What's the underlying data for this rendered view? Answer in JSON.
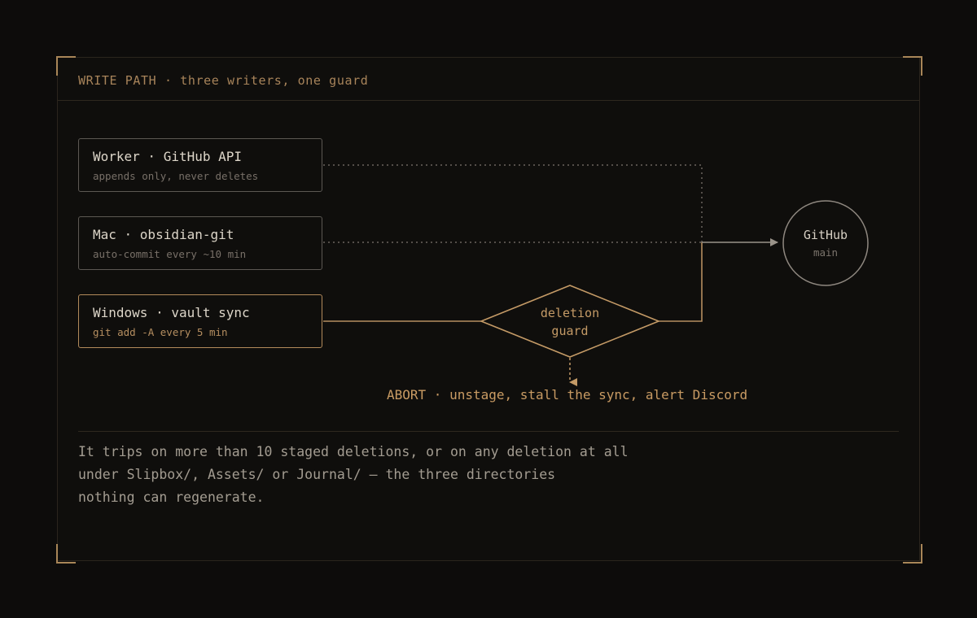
{
  "header": {
    "title": "WRITE PATH · three writers, one guard"
  },
  "writers": [
    {
      "name": "Worker · GitHub API",
      "detail": "appends only, never deletes"
    },
    {
      "name": "Mac · obsidian-git",
      "detail": "auto-commit every ~10 min"
    },
    {
      "name": "Windows · vault sync",
      "detail": "git add -A every 5 min"
    }
  ],
  "guard": {
    "line1": "deletion",
    "line2": "guard"
  },
  "repo": {
    "name": "GitHub",
    "branch": "main"
  },
  "abort_text": "ABORT · unstage, stall the sync, alert Discord",
  "note": {
    "line1": "It trips on more than 10 staged deletions, or on any deletion at all",
    "line2": "under Slipbox/, Assets/ or Journal/ — the three directories",
    "line3": "nothing can regenerate."
  },
  "colors": {
    "accent": "#c49a66",
    "muted_line": "#6b655e",
    "background": "#0d0c0b"
  }
}
